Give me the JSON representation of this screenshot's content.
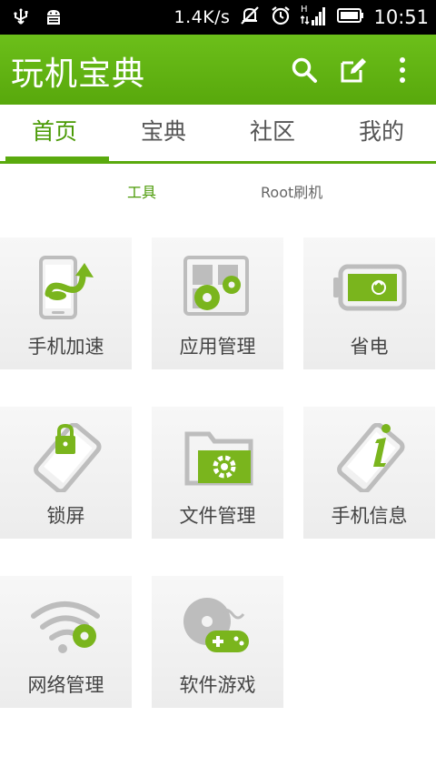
{
  "status_bar": {
    "speed": "1.4K/s",
    "time": "10:51"
  },
  "app_bar": {
    "title": "玩机宝典"
  },
  "tabs": [
    {
      "label": "首页",
      "active": true
    },
    {
      "label": "宝典",
      "active": false
    },
    {
      "label": "社区",
      "active": false
    },
    {
      "label": "我的",
      "active": false
    }
  ],
  "subtabs": [
    {
      "label": "工具",
      "active": true
    },
    {
      "label": "Root刷机",
      "active": false
    }
  ],
  "tools": [
    {
      "label": "手机加速",
      "icon": "phone-speedup-icon"
    },
    {
      "label": "应用管理",
      "icon": "app-manage-icon"
    },
    {
      "label": "省电",
      "icon": "battery-saver-icon"
    },
    {
      "label": "锁屏",
      "icon": "lock-screen-icon"
    },
    {
      "label": "文件管理",
      "icon": "file-manage-icon"
    },
    {
      "label": "手机信息",
      "icon": "phone-info-icon"
    },
    {
      "label": "网络管理",
      "icon": "network-manage-icon"
    },
    {
      "label": "软件游戏",
      "icon": "games-icon"
    }
  ],
  "colors": {
    "accent": "#5aaa0e",
    "icon_gray": "#bdbdbd",
    "icon_green": "#7ab51d"
  }
}
